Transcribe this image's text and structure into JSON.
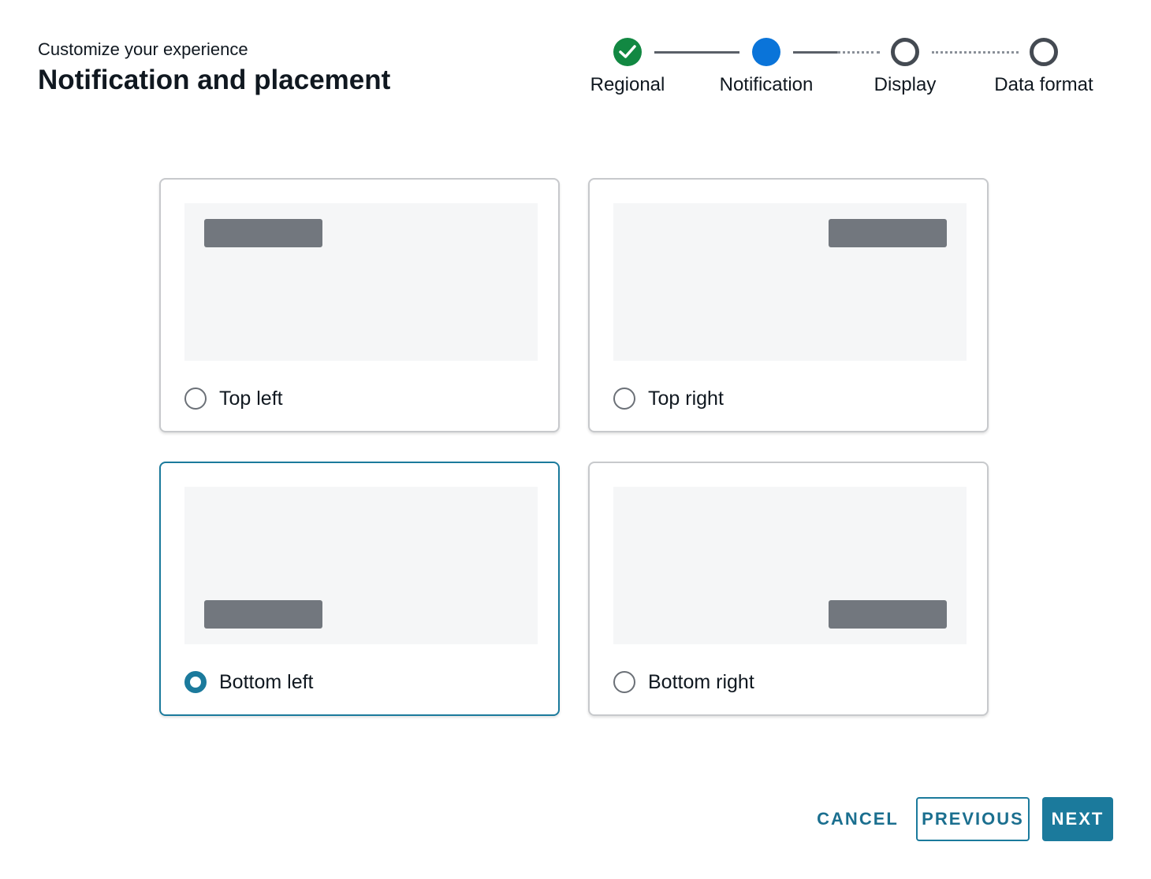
{
  "header": {
    "subtitle": "Customize your experience",
    "title": "Notification and placement"
  },
  "stepper": {
    "steps": [
      {
        "label": "Regional",
        "status": "complete"
      },
      {
        "label": "Notification",
        "status": "current"
      },
      {
        "label": "Display",
        "status": "upcoming"
      },
      {
        "label": "Data format",
        "status": "upcoming"
      }
    ],
    "colors": {
      "complete": "#128842",
      "current": "#0a74d9",
      "upcoming": "#444a52"
    }
  },
  "options": [
    {
      "label": "Top left",
      "position": "top-left",
      "selected": false
    },
    {
      "label": "Top right",
      "position": "top-right",
      "selected": false
    },
    {
      "label": "Bottom left",
      "position": "bottom-left",
      "selected": true
    },
    {
      "label": "Bottom right",
      "position": "bottom-right",
      "selected": false
    }
  ],
  "actions": {
    "cancel_label": "CANCEL",
    "previous_label": "PREVIOUS",
    "next_label": "NEXT"
  },
  "accent_color": "#1b7a9c"
}
